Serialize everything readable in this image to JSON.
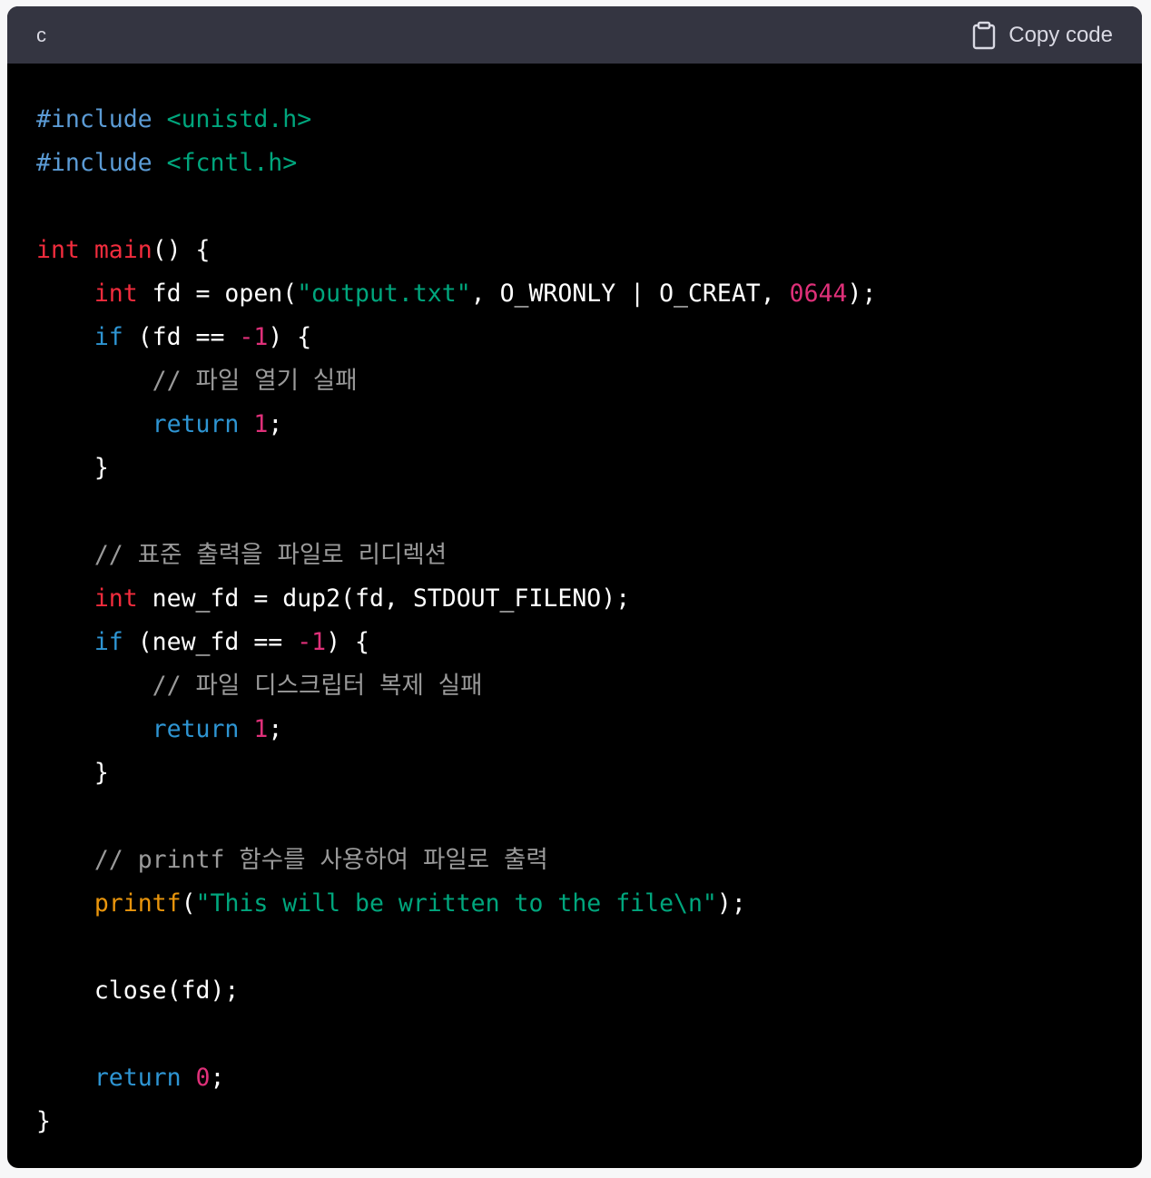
{
  "header": {
    "language": "c",
    "copy_label": "Copy code"
  },
  "colors": {
    "header_bg": "#343541",
    "code_bg": "#000000",
    "keyword": "#2e95d3",
    "type": "#f22c3d",
    "string": "#00a67d",
    "number": "#df3079",
    "comment": "#9a9a9a",
    "builtin": "#e9950c"
  },
  "icons": {
    "copy": "clipboard-icon"
  },
  "code_lines": [
    [
      {
        "t": "preproc",
        "v": "#include"
      },
      {
        "t": "plain",
        "v": " "
      },
      {
        "t": "header",
        "v": "<unistd.h>"
      }
    ],
    [
      {
        "t": "preproc",
        "v": "#include"
      },
      {
        "t": "plain",
        "v": " "
      },
      {
        "t": "header",
        "v": "<fcntl.h>"
      }
    ],
    [],
    [
      {
        "t": "type",
        "v": "int"
      },
      {
        "t": "plain",
        "v": " "
      },
      {
        "t": "func",
        "v": "main"
      },
      {
        "t": "plain",
        "v": "() {"
      }
    ],
    [
      {
        "t": "plain",
        "v": "    "
      },
      {
        "t": "type",
        "v": "int"
      },
      {
        "t": "plain",
        "v": " fd = open("
      },
      {
        "t": "string",
        "v": "\"output.txt\""
      },
      {
        "t": "plain",
        "v": ", O_WRONLY | O_CREAT, "
      },
      {
        "t": "number",
        "v": "0644"
      },
      {
        "t": "plain",
        "v": ");"
      }
    ],
    [
      {
        "t": "plain",
        "v": "    "
      },
      {
        "t": "keyword",
        "v": "if"
      },
      {
        "t": "plain",
        "v": " (fd == "
      },
      {
        "t": "number",
        "v": "-1"
      },
      {
        "t": "plain",
        "v": ") {"
      }
    ],
    [
      {
        "t": "plain",
        "v": "        "
      },
      {
        "t": "comment",
        "v": "// 파일 열기 실패"
      }
    ],
    [
      {
        "t": "plain",
        "v": "        "
      },
      {
        "t": "keyword",
        "v": "return"
      },
      {
        "t": "plain",
        "v": " "
      },
      {
        "t": "number",
        "v": "1"
      },
      {
        "t": "plain",
        "v": ";"
      }
    ],
    [
      {
        "t": "plain",
        "v": "    }"
      }
    ],
    [],
    [
      {
        "t": "plain",
        "v": "    "
      },
      {
        "t": "comment",
        "v": "// 표준 출력을 파일로 리디렉션"
      }
    ],
    [
      {
        "t": "plain",
        "v": "    "
      },
      {
        "t": "type",
        "v": "int"
      },
      {
        "t": "plain",
        "v": " new_fd = dup2(fd, STDOUT_FILENO);"
      }
    ],
    [
      {
        "t": "plain",
        "v": "    "
      },
      {
        "t": "keyword",
        "v": "if"
      },
      {
        "t": "plain",
        "v": " (new_fd == "
      },
      {
        "t": "number",
        "v": "-1"
      },
      {
        "t": "plain",
        "v": ") {"
      }
    ],
    [
      {
        "t": "plain",
        "v": "        "
      },
      {
        "t": "comment",
        "v": "// 파일 디스크립터 복제 실패"
      }
    ],
    [
      {
        "t": "plain",
        "v": "        "
      },
      {
        "t": "keyword",
        "v": "return"
      },
      {
        "t": "plain",
        "v": " "
      },
      {
        "t": "number",
        "v": "1"
      },
      {
        "t": "plain",
        "v": ";"
      }
    ],
    [
      {
        "t": "plain",
        "v": "    }"
      }
    ],
    [],
    [
      {
        "t": "plain",
        "v": "    "
      },
      {
        "t": "comment",
        "v": "// printf 함수를 사용하여 파일로 출력"
      }
    ],
    [
      {
        "t": "plain",
        "v": "    "
      },
      {
        "t": "builtin",
        "v": "printf"
      },
      {
        "t": "plain",
        "v": "("
      },
      {
        "t": "string",
        "v": "\"This will be written to the file\\n\""
      },
      {
        "t": "plain",
        "v": ");"
      }
    ],
    [],
    [
      {
        "t": "plain",
        "v": "    close(fd);"
      }
    ],
    [],
    [
      {
        "t": "plain",
        "v": "    "
      },
      {
        "t": "keyword",
        "v": "return"
      },
      {
        "t": "plain",
        "v": " "
      },
      {
        "t": "number",
        "v": "0"
      },
      {
        "t": "plain",
        "v": ";"
      }
    ],
    [
      {
        "t": "plain",
        "v": "}"
      }
    ]
  ]
}
